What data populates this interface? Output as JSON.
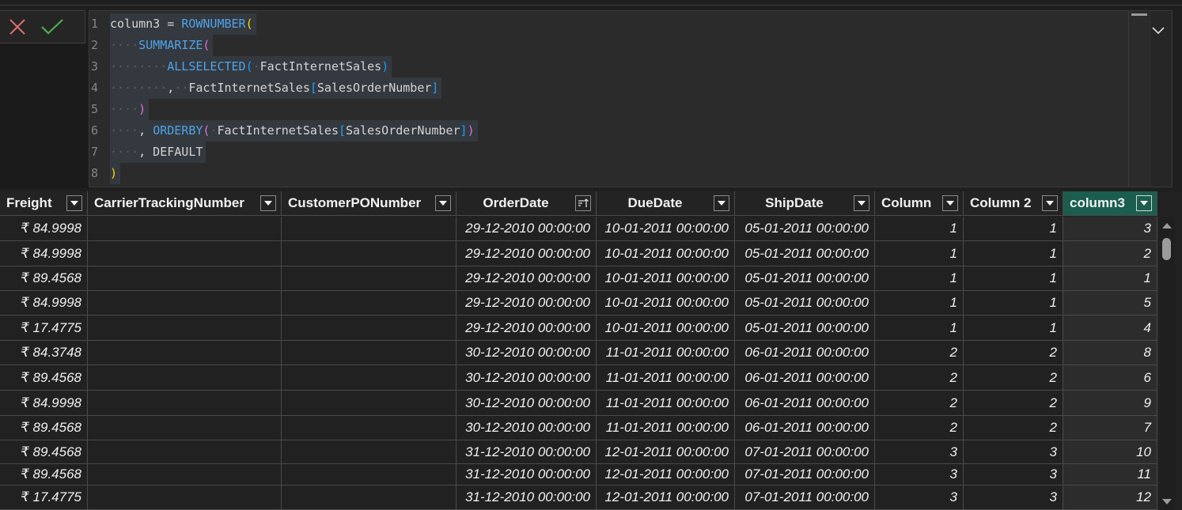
{
  "editor": {
    "lines": [
      {
        "n": "1",
        "tokens": [
          [
            "p",
            "column3 = "
          ],
          [
            "f",
            "ROWNUMBER"
          ],
          [
            "b",
            "("
          ]
        ]
      },
      {
        "n": "2",
        "tokens": [
          [
            "w",
            "····"
          ],
          [
            "f",
            "SUMMARIZE"
          ],
          [
            "b2",
            "("
          ]
        ]
      },
      {
        "n": "3",
        "tokens": [
          [
            "w",
            "········"
          ],
          [
            "f",
            "ALLSELECTED"
          ],
          [
            "b3",
            "("
          ],
          [
            "w",
            "·"
          ],
          [
            "p",
            "FactInternetSales"
          ],
          [
            "b3",
            ")"
          ]
        ]
      },
      {
        "n": "4",
        "tokens": [
          [
            "w",
            "········"
          ],
          [
            "p",
            ","
          ],
          [
            "w",
            "··"
          ],
          [
            "p",
            "FactInternetSales"
          ],
          [
            "b3",
            "["
          ],
          [
            "p",
            "SalesOrderNumber"
          ],
          [
            "b3",
            "]"
          ]
        ]
      },
      {
        "n": "5",
        "tokens": [
          [
            "w",
            "····"
          ],
          [
            "b2",
            ")"
          ]
        ]
      },
      {
        "n": "6",
        "tokens": [
          [
            "w",
            "····"
          ],
          [
            "p",
            ", "
          ],
          [
            "f",
            "ORDERBY"
          ],
          [
            "b2",
            "("
          ],
          [
            "w",
            "·"
          ],
          [
            "p",
            "FactInternetSales"
          ],
          [
            "b3",
            "["
          ],
          [
            "p",
            "SalesOrderNumber"
          ],
          [
            "b3",
            "]"
          ],
          [
            "b2",
            ")"
          ]
        ]
      },
      {
        "n": "7",
        "tokens": [
          [
            "w",
            "····"
          ],
          [
            "p",
            ", DEFAULT"
          ]
        ]
      },
      {
        "n": "8",
        "tokens": [
          [
            "b",
            ")"
          ]
        ]
      }
    ]
  },
  "table": {
    "columns": [
      {
        "label": "Freight"
      },
      {
        "label": "CarrierTrackingNumber"
      },
      {
        "label": "CustomerPONumber"
      },
      {
        "label": "OrderDate"
      },
      {
        "label": "DueDate"
      },
      {
        "label": "ShipDate"
      },
      {
        "label": "Column"
      },
      {
        "label": "Column 2"
      },
      {
        "label": "column3"
      }
    ],
    "rows": [
      [
        "₹ 84.9998",
        "",
        "",
        "29-12-2010 00:00:00",
        "10-01-2011 00:00:00",
        "05-01-2011 00:00:00",
        "1",
        "1",
        "3"
      ],
      [
        "₹ 84.9998",
        "",
        "",
        "29-12-2010 00:00:00",
        "10-01-2011 00:00:00",
        "05-01-2011 00:00:00",
        "1",
        "1",
        "2"
      ],
      [
        "₹ 89.4568",
        "",
        "",
        "29-12-2010 00:00:00",
        "10-01-2011 00:00:00",
        "05-01-2011 00:00:00",
        "1",
        "1",
        "1"
      ],
      [
        "₹ 84.9998",
        "",
        "",
        "29-12-2010 00:00:00",
        "10-01-2011 00:00:00",
        "05-01-2011 00:00:00",
        "1",
        "1",
        "5"
      ],
      [
        "₹ 17.4775",
        "",
        "",
        "29-12-2010 00:00:00",
        "10-01-2011 00:00:00",
        "05-01-2011 00:00:00",
        "1",
        "1",
        "4"
      ],
      [
        "₹ 84.3748",
        "",
        "",
        "30-12-2010 00:00:00",
        "11-01-2011 00:00:00",
        "06-01-2011 00:00:00",
        "2",
        "2",
        "8"
      ],
      [
        "₹ 89.4568",
        "",
        "",
        "30-12-2010 00:00:00",
        "11-01-2011 00:00:00",
        "06-01-2011 00:00:00",
        "2",
        "2",
        "6"
      ],
      [
        "₹ 84.9998",
        "",
        "",
        "30-12-2010 00:00:00",
        "11-01-2011 00:00:00",
        "06-01-2011 00:00:00",
        "2",
        "2",
        "9"
      ],
      [
        "₹ 89.4568",
        "",
        "",
        "30-12-2010 00:00:00",
        "11-01-2011 00:00:00",
        "06-01-2011 00:00:00",
        "2",
        "2",
        "7"
      ],
      [
        "₹ 89.4568",
        "",
        "",
        "31-12-2010 00:00:00",
        "12-01-2011 00:00:00",
        "07-01-2011 00:00:00",
        "3",
        "3",
        "10"
      ],
      [
        "₹ 89.4568",
        "",
        "",
        "31-12-2010 00:00:00",
        "12-01-2011 00:00:00",
        "07-01-2011 00:00:00",
        "3",
        "3",
        "11"
      ],
      [
        "₹ 17.4775",
        "",
        "",
        "31-12-2010 00:00:00",
        "12-01-2011 00:00:00",
        "07-01-2011 00:00:00",
        "3",
        "3",
        "12"
      ]
    ]
  },
  "colors": {
    "accent_header": "#1b5e4f",
    "cancel": "#e06c6c",
    "commit": "#4caf50"
  },
  "icons": {
    "cancel": "close-icon",
    "commit": "checkmark-icon",
    "collapse": "chevron-down-icon",
    "filter": "dropdown-arrow-icon",
    "sorted": "sort-ascending-icon"
  }
}
